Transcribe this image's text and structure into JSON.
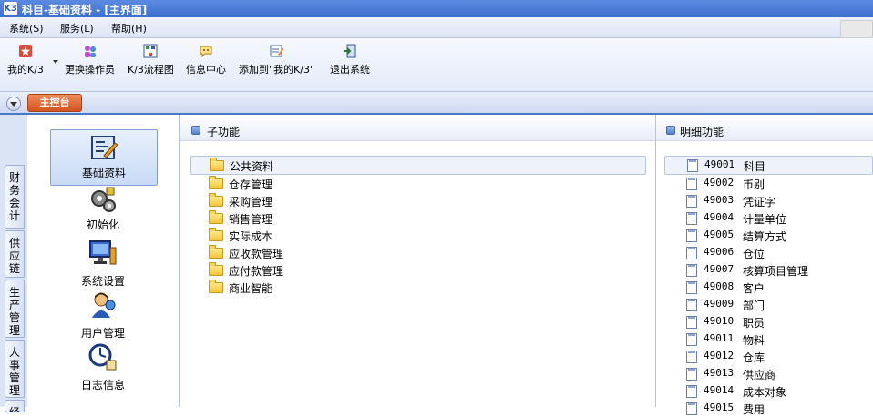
{
  "window": {
    "logo": "K3",
    "title": "科目-基础资料 - [主界面]"
  },
  "menu": [
    "系统(S)",
    "服务(L)",
    "帮助(H)"
  ],
  "toolbar": [
    {
      "label": "我的K/3",
      "icon": "star-icon"
    },
    {
      "label": "更换操作员",
      "icon": "switch-user-icon"
    },
    {
      "label": "K/3流程图",
      "icon": "flowchart-icon"
    },
    {
      "label": "信息中心",
      "icon": "message-icon"
    },
    {
      "label": "添加到\"我的K/3\"",
      "icon": "add-favorite-icon"
    },
    {
      "label": "退出系统",
      "icon": "exit-icon"
    }
  ],
  "main_tab": "主控台",
  "side_tabs": [
    "财务会计",
    "供应链",
    "生产管理",
    "人事管理",
    "经"
  ],
  "modules": [
    {
      "label": "基础资料",
      "icon": "basic-data-icon",
      "selected": true
    },
    {
      "label": "初始化",
      "icon": "initialize-icon"
    },
    {
      "label": "系统设置",
      "icon": "system-settings-icon"
    },
    {
      "label": "用户管理",
      "icon": "user-management-icon"
    },
    {
      "label": "日志信息",
      "icon": "log-icon"
    }
  ],
  "subfunctions": {
    "title": "子功能",
    "items": [
      "公共资料",
      "仓存管理",
      "采购管理",
      "销售管理",
      "实际成本",
      "应收款管理",
      "应付款管理",
      "商业智能"
    ]
  },
  "details": {
    "title": "明细功能",
    "items": [
      {
        "code": "49001",
        "name": "科目"
      },
      {
        "code": "49002",
        "name": "币别"
      },
      {
        "code": "49003",
        "name": "凭证字"
      },
      {
        "code": "49004",
        "name": "计量单位"
      },
      {
        "code": "49005",
        "name": "结算方式"
      },
      {
        "code": "49006",
        "name": "仓位"
      },
      {
        "code": "49007",
        "name": "核算项目管理"
      },
      {
        "code": "49008",
        "name": "客户"
      },
      {
        "code": "49009",
        "name": "部门"
      },
      {
        "code": "49010",
        "name": "职员"
      },
      {
        "code": "49011",
        "name": "物料"
      },
      {
        "code": "49012",
        "name": "仓库"
      },
      {
        "code": "49013",
        "name": "供应商"
      },
      {
        "code": "49014",
        "name": "成本对象"
      },
      {
        "code": "49015",
        "name": "费用"
      }
    ]
  }
}
